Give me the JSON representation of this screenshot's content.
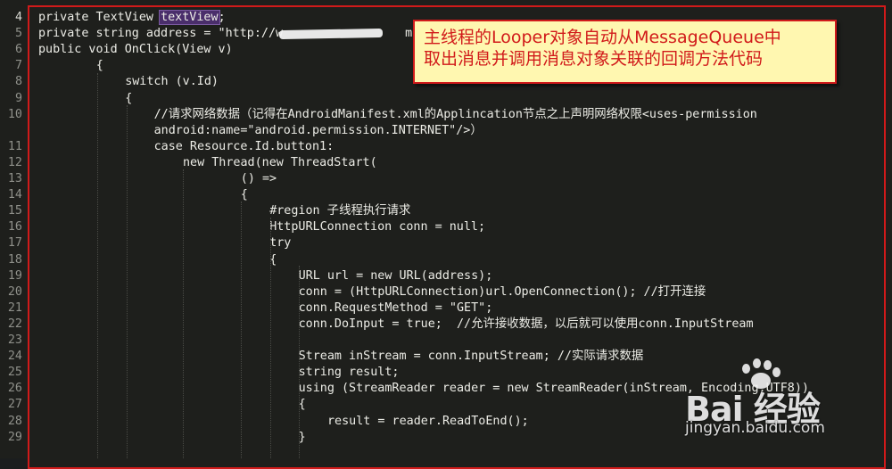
{
  "editor": {
    "lines": [
      {
        "num": "4",
        "indent": 0,
        "pre": "private TextView ",
        "highlight": "textView",
        "post": ";",
        "current": true
      },
      {
        "num": "5",
        "indent": 0,
        "text": "private string address = \"http://w                 m\";"
      },
      {
        "num": "6",
        "indent": 0,
        "text": "public void OnClick(View v)"
      },
      {
        "num": "7",
        "indent": 2,
        "text": "{"
      },
      {
        "num": "8",
        "indent": 3,
        "text": "switch (v.Id)"
      },
      {
        "num": "9",
        "indent": 3,
        "text": "{"
      },
      {
        "num": "10",
        "indent": 4,
        "text": "//请求网络数据（记得在AndroidManifest.xml的Applincation节点之上声明网络权限<uses-permission"
      },
      {
        "num": "",
        "indent": 4,
        "text": "android:name=\"android.permission.INTERNET\"/>）"
      },
      {
        "num": "11",
        "indent": 4,
        "text": "case Resource.Id.button1:"
      },
      {
        "num": "12",
        "indent": 5,
        "text": "new Thread(new ThreadStart("
      },
      {
        "num": "13",
        "indent": 7,
        "text": "() =>"
      },
      {
        "num": "14",
        "indent": 7,
        "text": "{"
      },
      {
        "num": "15",
        "indent": 8,
        "text": "#region 子线程执行请求"
      },
      {
        "num": "16",
        "indent": 8,
        "text": "HttpURLConnection conn = null;"
      },
      {
        "num": "17",
        "indent": 8,
        "text": "try"
      },
      {
        "num": "18",
        "indent": 8,
        "text": "{"
      },
      {
        "num": "19",
        "indent": 9,
        "text": "URL url = new URL(address);"
      },
      {
        "num": "20",
        "indent": 9,
        "text": "conn = (HttpURLConnection)url.OpenConnection(); //打开连接"
      },
      {
        "num": "21",
        "indent": 9,
        "text": "conn.RequestMethod = \"GET\";"
      },
      {
        "num": "22",
        "indent": 9,
        "text": "conn.DoInput = true;  //允许接收数据，以后就可以使用conn.InputStream"
      },
      {
        "num": "23",
        "indent": 9,
        "text": ""
      },
      {
        "num": "24",
        "indent": 9,
        "text": "Stream inStream = conn.InputStream; //实际请求数据"
      },
      {
        "num": "25",
        "indent": 9,
        "text": "string result;"
      },
      {
        "num": "26",
        "indent": 9,
        "text": "using (StreamReader reader = new StreamReader(inStream, Encoding.UTF8))"
      },
      {
        "num": "27",
        "indent": 9,
        "text": "{"
      },
      {
        "num": "28",
        "indent": 10,
        "text": "result = reader.ReadToEnd();"
      },
      {
        "num": "29",
        "indent": 9,
        "text": "}"
      }
    ]
  },
  "callout": {
    "line1": "主线程的Looper对象自动从MessageQueue中",
    "line2": "取出消息并调用消息对象关联的回调方法代码"
  },
  "watermark": {
    "brand": "Bai  经验",
    "url": "jingyan.baidu.com"
  },
  "colors": {
    "background": "#1e1f1c",
    "text": "#ecece6",
    "line_number": "#8f908a",
    "frame": "#d11a1a",
    "callout_bg": "#fff7b0",
    "highlight": "#4a2e6b"
  }
}
